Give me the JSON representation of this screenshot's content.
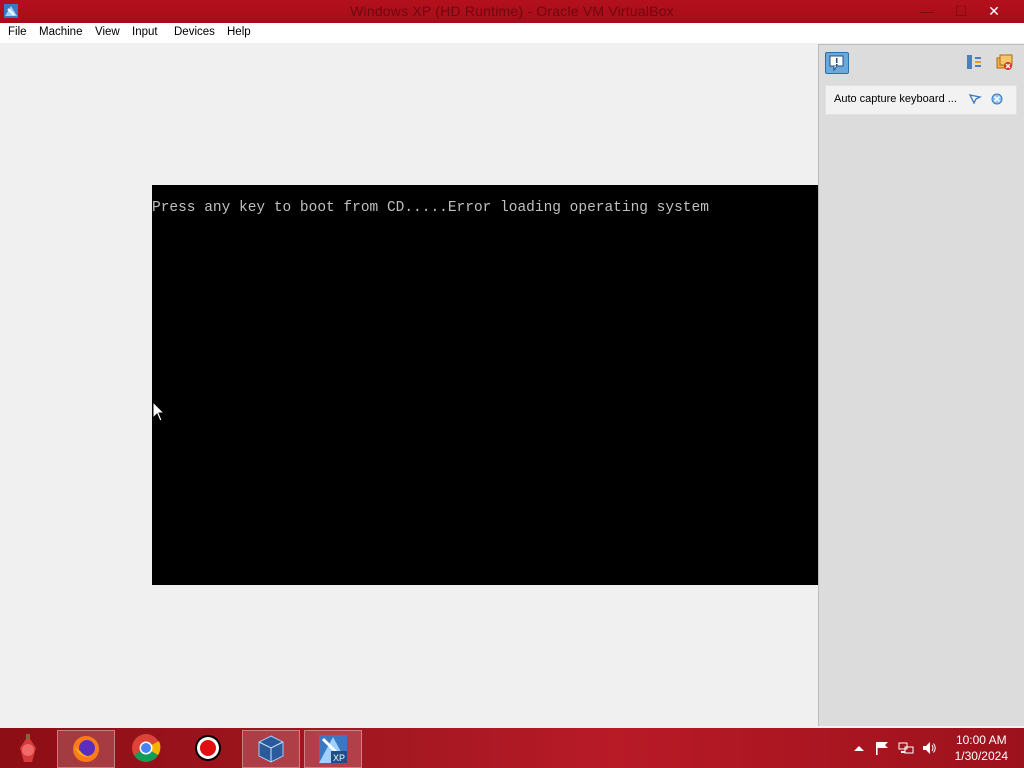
{
  "window": {
    "title": "Windows XP (HD Runtime) - Oracle VM VirtualBox",
    "minimize_symbol": "—",
    "maximize_symbol": "☐",
    "close_symbol": "✕"
  },
  "menu": {
    "items": [
      "File",
      "Machine",
      "View",
      "Input",
      "Devices",
      "Help"
    ]
  },
  "vm": {
    "console_text": "Press any key to boot from CD.....Error loading operating system"
  },
  "notification_panel": {
    "message": "Auto capture keyboard ...",
    "icons": [
      "info-icon",
      "collapse-panel-icon",
      "close-all-icon",
      "mouse-pointer-icon",
      "dismiss-icon"
    ]
  },
  "taskbar": {
    "apps": [
      "start-orb",
      "firefox-icon",
      "chrome-icon",
      "recorder-icon",
      "virtualbox-icon",
      "windows-xp-vm-icon"
    ],
    "tray": [
      "show-hidden-icons",
      "action-center-flag-icon",
      "network-icon",
      "volume-icon"
    ],
    "time": "10:00 AM",
    "date": "1/30/2024"
  },
  "colors": {
    "title_bar": "#b3101d",
    "taskbar": "#a51822",
    "console_bg": "#000000",
    "console_fg": "#bfbfbf"
  }
}
